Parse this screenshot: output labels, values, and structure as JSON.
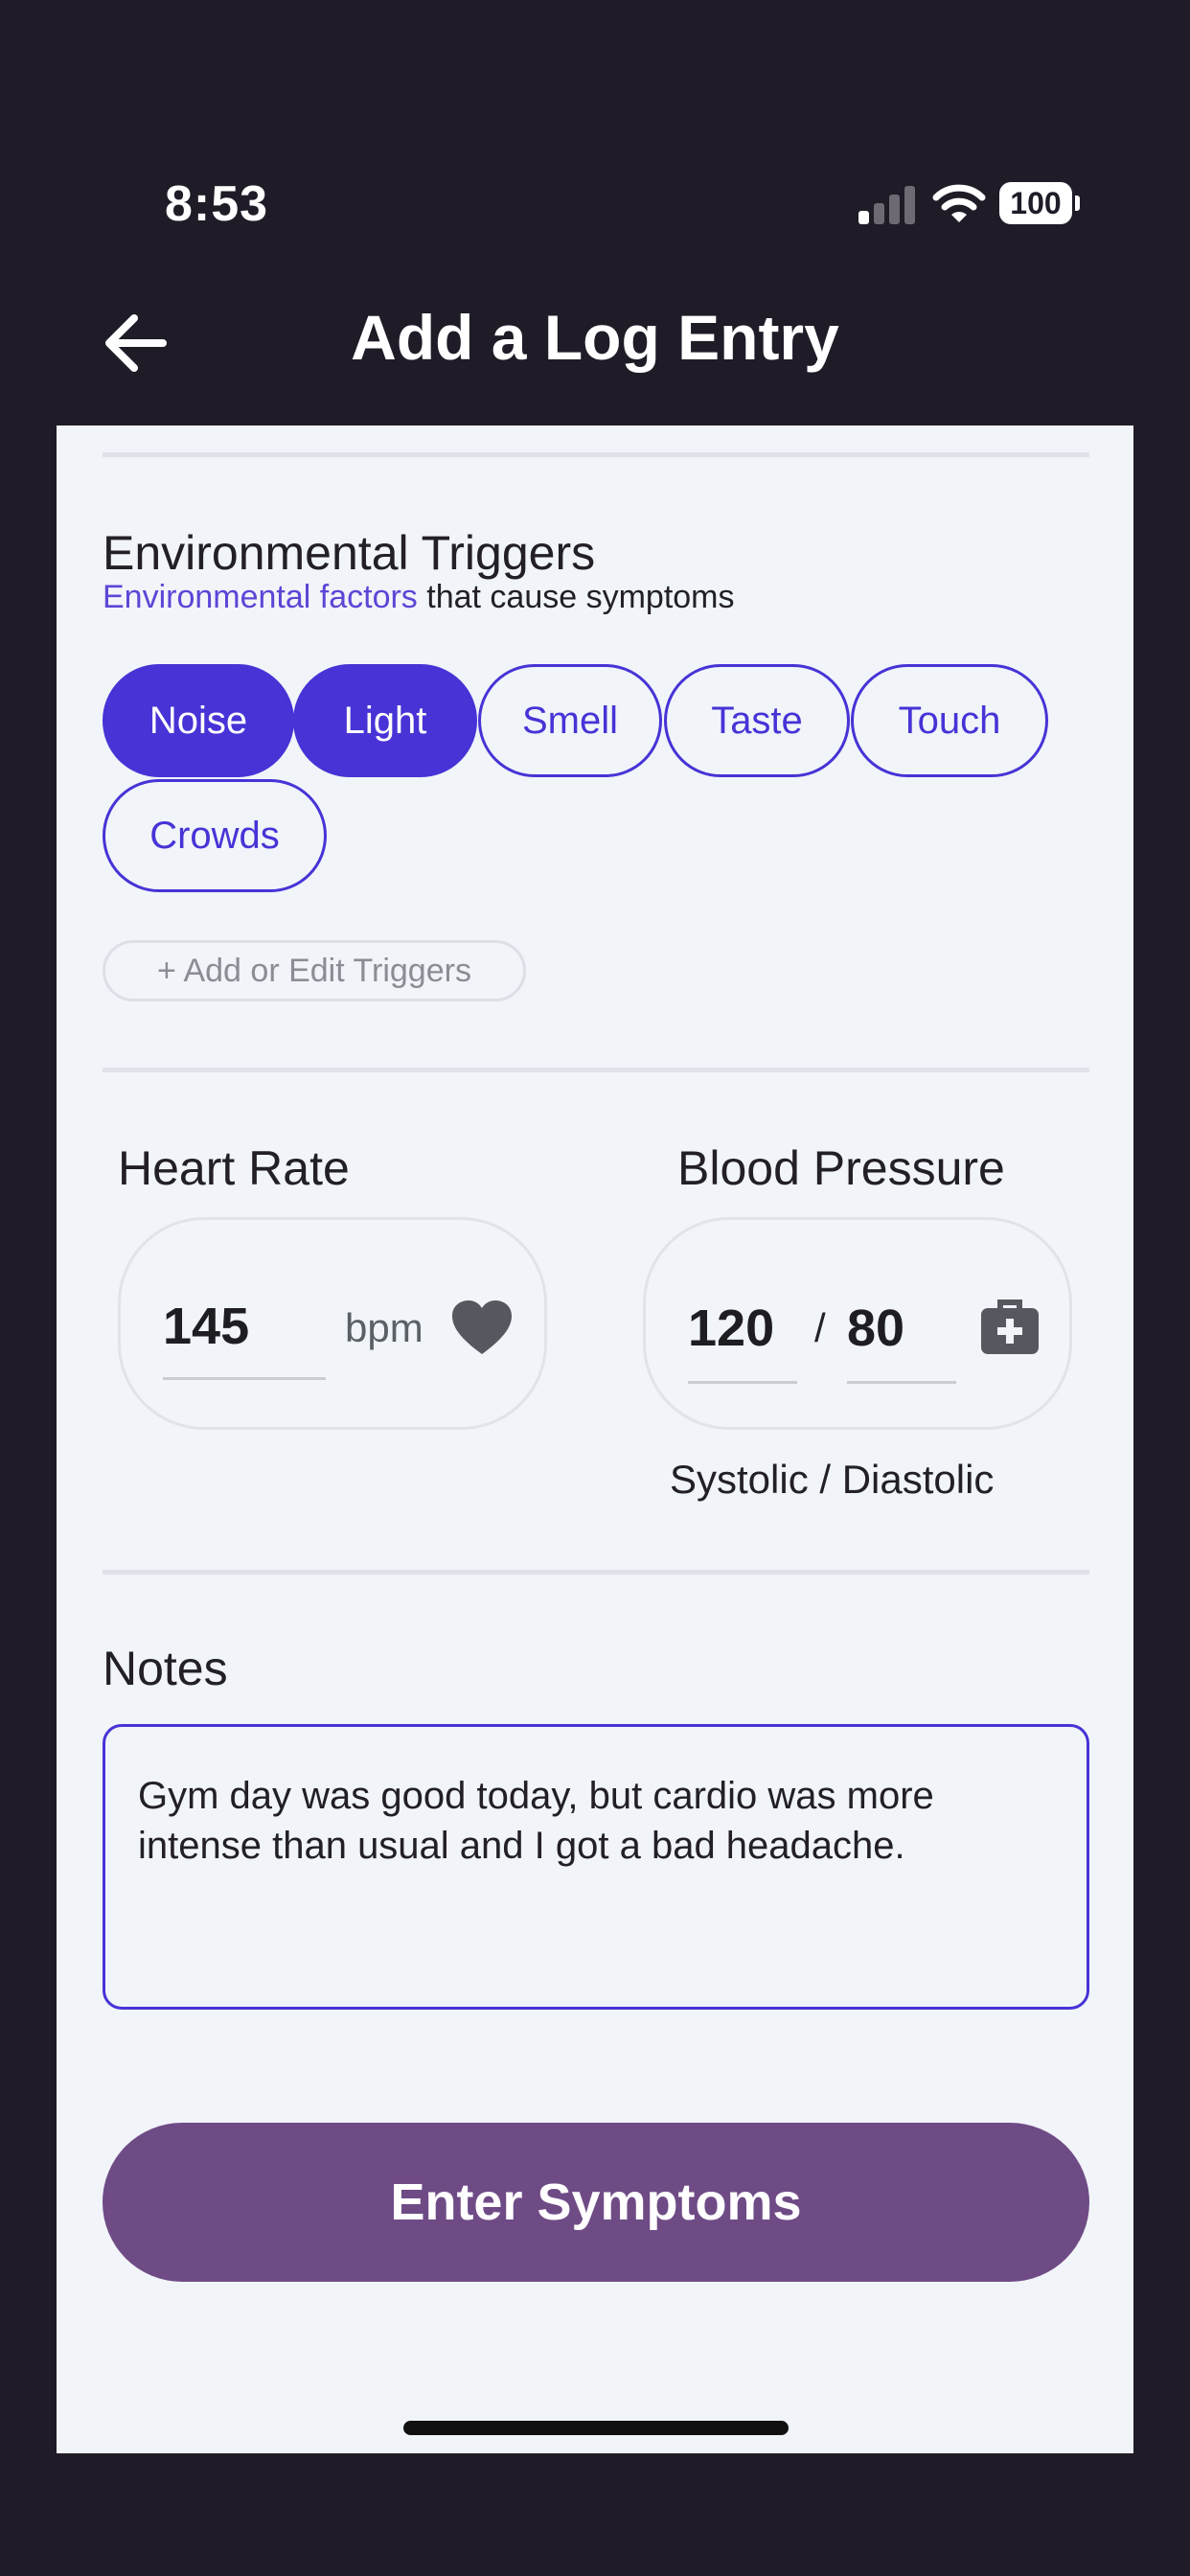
{
  "status_bar": {
    "time": "8:53",
    "battery": "100",
    "icons": [
      "signal-icon",
      "wifi-icon",
      "battery-icon"
    ]
  },
  "nav": {
    "title": "Add a Log Entry",
    "back_icon": "arrow-left-icon"
  },
  "environmental_triggers": {
    "title": "Environmental Triggers",
    "subtitle_accent": "Environmental factors",
    "subtitle_rest": " that cause symptoms",
    "chips": [
      {
        "label": "Noise",
        "selected": true
      },
      {
        "label": "Light",
        "selected": true
      },
      {
        "label": "Smell",
        "selected": false
      },
      {
        "label": "Taste",
        "selected": false
      },
      {
        "label": "Touch",
        "selected": false
      },
      {
        "label": "Crowds",
        "selected": false
      }
    ],
    "add_button": "+ Add or Edit Triggers"
  },
  "vitals": {
    "heart_rate": {
      "title": "Heart Rate",
      "value": "145",
      "unit": "bpm",
      "icon": "heart-icon"
    },
    "blood_pressure": {
      "title": "Blood Pressure",
      "systolic": "120",
      "separator": "/",
      "diastolic": "80",
      "caption": "Systolic / Diastolic",
      "icon": "medical-kit-icon"
    }
  },
  "notes": {
    "title": "Notes",
    "value": "Gym day was good today, but cardio was more intense than usual and I got a bad headache."
  },
  "submit": {
    "label": "Enter Symptoms"
  },
  "colors": {
    "background": "#1f1b27",
    "sheet": "#f1f4f9",
    "accent": "#4733d6",
    "button": "#6f4b86",
    "icon_gray": "#55595f"
  }
}
